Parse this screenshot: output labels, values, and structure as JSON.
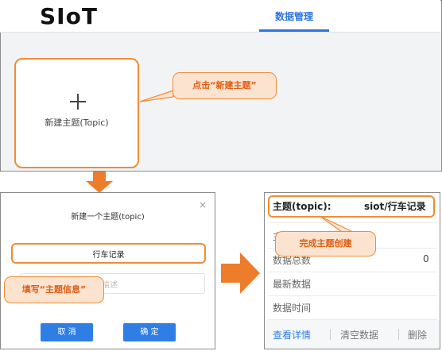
{
  "header": {
    "logo": "SIoT",
    "nav_tab": "数据管理"
  },
  "new_topic_card": {
    "label": "新建主题(Topic)"
  },
  "callouts": {
    "step1": "点击“新建主题”",
    "step2": "填写“主题信息”",
    "step3": "完成主题创建"
  },
  "dialog": {
    "title": "新建一个主题(topic)",
    "topic_value": "行车记录",
    "description_placeholder": "描述",
    "cancel_label": "取 消",
    "confirm_label": "确 定"
  },
  "topic_card": {
    "title_label": "主题(topic):",
    "title_value": "siot/行车记录",
    "row1_label": "主",
    "message_count_label": "数据总数",
    "message_count_value": "0",
    "latest_data_label": "最新数据",
    "data_time_label": "数据时间",
    "view_details": "查看详情",
    "clear_data": "清空数据",
    "delete": "删除"
  },
  "colors": {
    "accent_orange": "#ef8c36",
    "callout_fill": "#fce3cf",
    "primary_blue": "#2f7ee6"
  }
}
